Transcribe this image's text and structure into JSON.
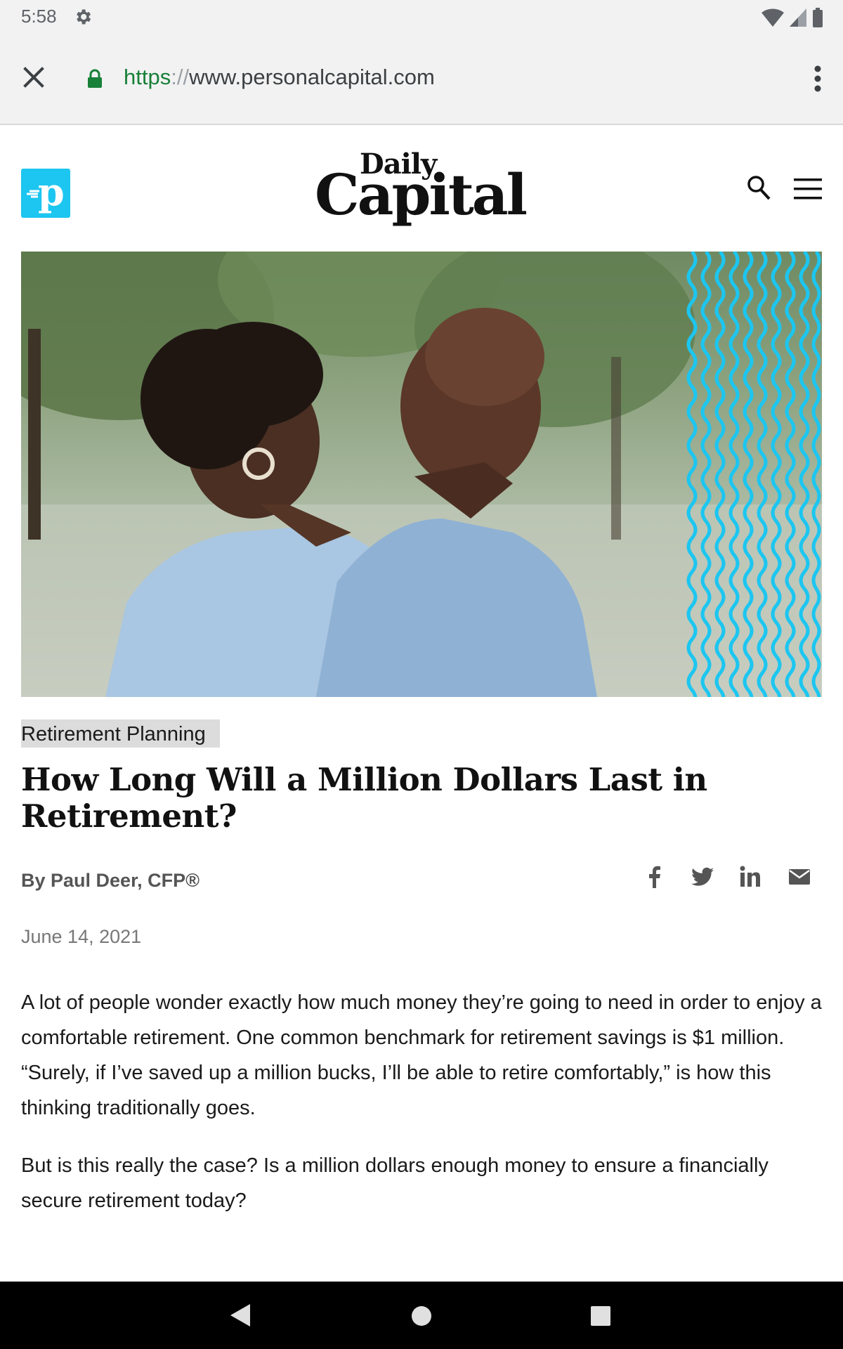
{
  "status_bar": {
    "time": "5:58",
    "icons": [
      "settings-gear-icon",
      "wifi-icon",
      "signal-icon",
      "battery-icon"
    ]
  },
  "browser": {
    "url_scheme": "https",
    "url_separator": "://",
    "url_host": "www.personalcapital.com",
    "icons": [
      "close-icon",
      "lock-icon",
      "more-vert-icon"
    ],
    "colors": {
      "secure": "#188038",
      "chrome_bg": "#f2f2f2"
    }
  },
  "site": {
    "logo_letter": "p",
    "masthead_small": "Daily",
    "masthead_big": "Capital",
    "icons": [
      "search-icon",
      "hamburger-menu-icon"
    ],
    "colors": {
      "brand_cyan": "#1cc6f0"
    }
  },
  "hero": {
    "description_icon": "hero-photo"
  },
  "article": {
    "category": "Retirement Planning",
    "title": "How Long Will a Million Dollars Last in Retirement?",
    "byline": "By Paul Deer, CFP®",
    "date": "June 14, 2021",
    "share_icons": [
      "facebook-icon",
      "twitter-icon",
      "linkedin-icon",
      "email-icon"
    ],
    "paragraphs": [
      "A lot of people wonder exactly how much money they’re going to need in order to enjoy a comfortable retirement. One common benchmark for retirement savings is $1 million. “Surely, if I’ve saved up a million bucks, I’ll be able to retire comfortably,” is how this thinking traditionally goes.",
      "But is this really the case? Is a million dollars enough money to ensure a financially secure retirement today?"
    ]
  },
  "nav_bar": {
    "icons": [
      "back-icon",
      "home-icon",
      "recents-icon"
    ]
  }
}
